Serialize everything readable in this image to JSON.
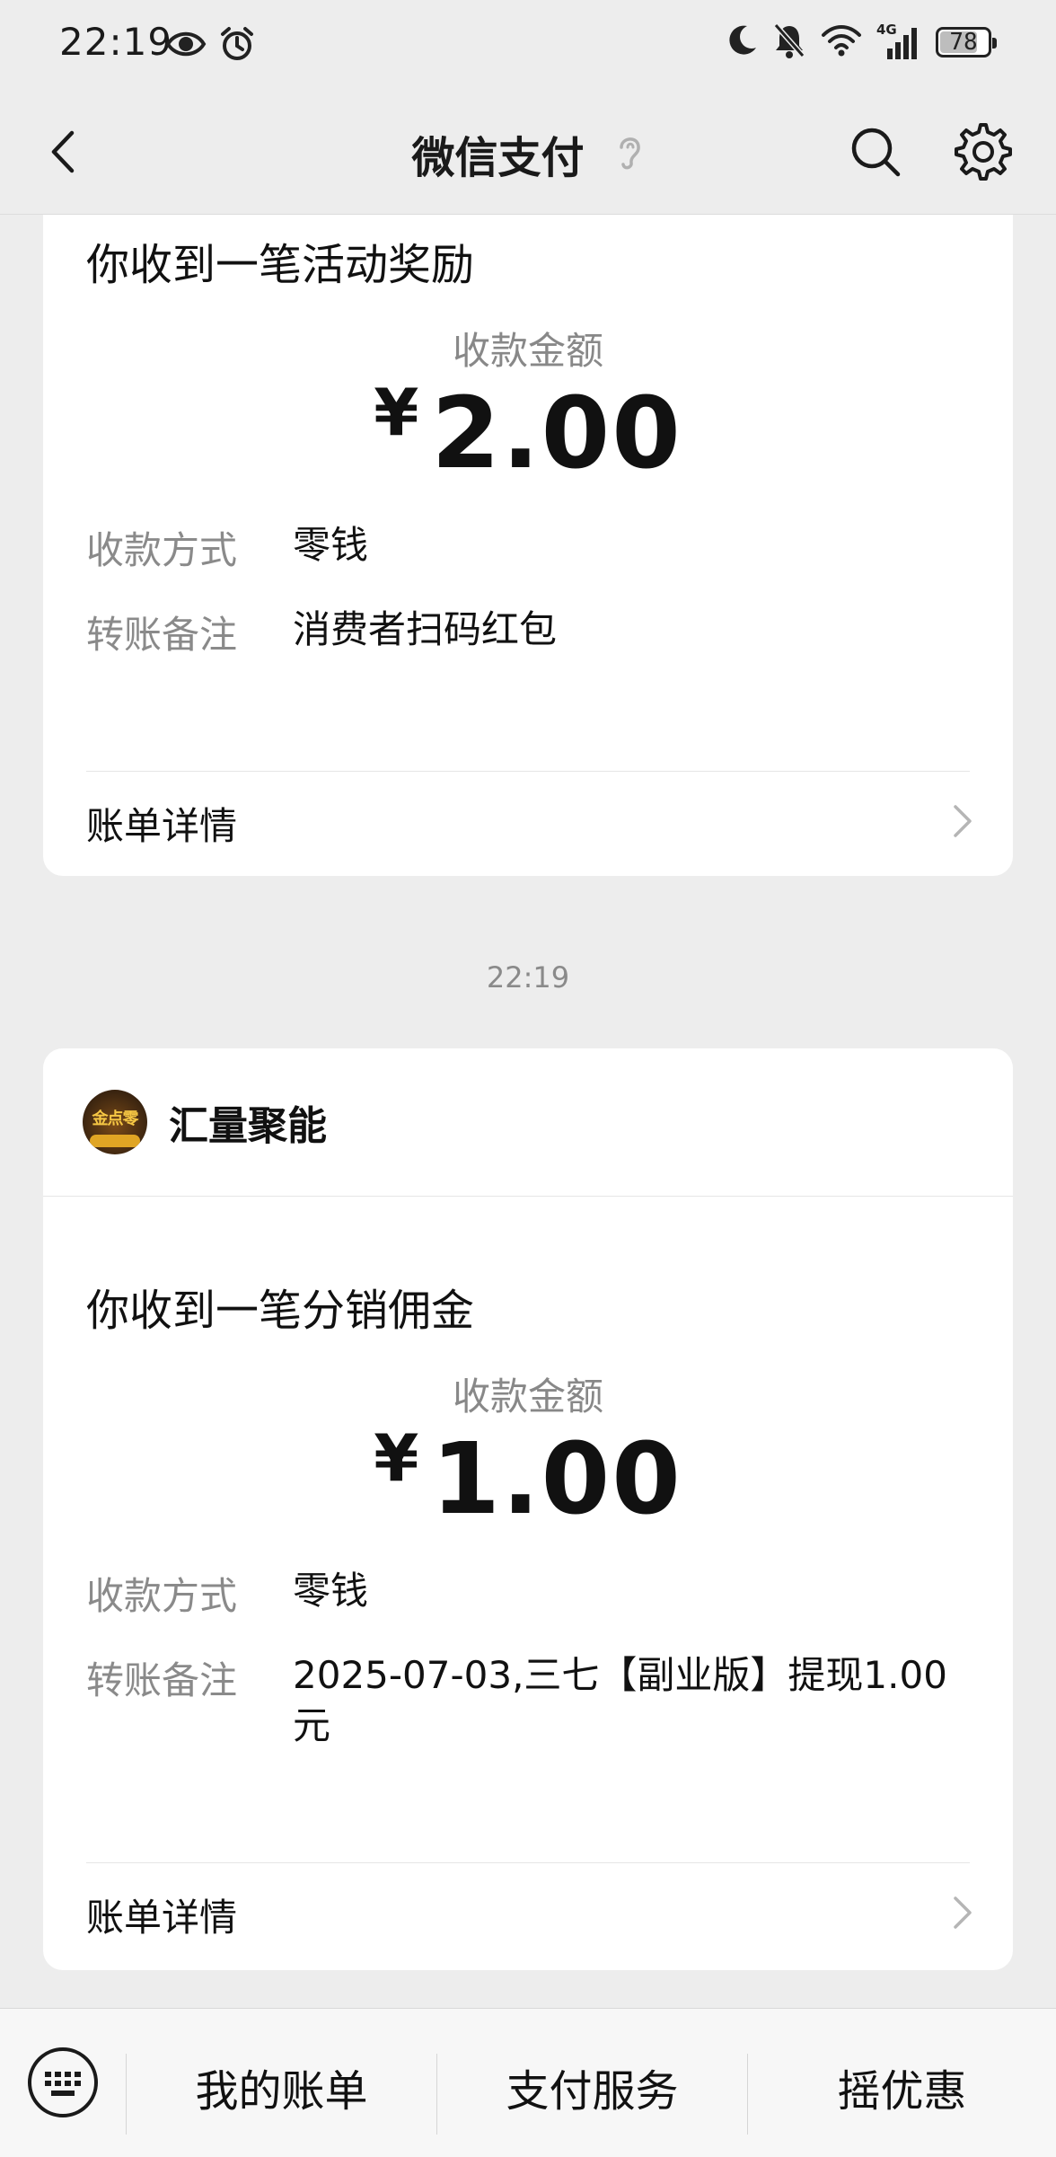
{
  "status_bar": {
    "time": "22:19",
    "left_icons": [
      "eye-icon",
      "alarm-icon"
    ],
    "right_icons": [
      "moon-icon",
      "bell-off-icon",
      "wifi-icon",
      "signal-4g-icon"
    ],
    "network": "4G",
    "battery": "78",
    "battery_level_percent": 78
  },
  "nav": {
    "title": "微信支付",
    "icons": [
      "back-icon",
      "ear-icon",
      "search-icon",
      "settings-icon"
    ]
  },
  "card1": {
    "notice": "你收到一笔活动奖励",
    "amount_label": "收款金额",
    "currency": "¥",
    "amount": "2.00",
    "method_key": "收款方式",
    "method_value": "零钱",
    "remark_key": "转账备注",
    "remark_value": "消费者扫码红包",
    "detail_label": "账单详情"
  },
  "time_separator": "22:19",
  "card2": {
    "avatar_text": "金点零",
    "merchant": "汇量聚能",
    "notice": "你收到一笔分销佣金",
    "amount_label": "收款金额",
    "currency": "¥",
    "amount": "1.00",
    "method_key": "收款方式",
    "method_value": "零钱",
    "remark_key": "转账备注",
    "remark_value": "2025-07-03,三七【副业版】提现1.00元",
    "detail_label": "账单详情"
  },
  "bottom_bar": {
    "keyboard_icon": "keyboard-icon",
    "menus": [
      "我的账单",
      "支付服务",
      "摇优惠"
    ]
  },
  "colors": {
    "page_bg": "#ededed",
    "card_bg": "#ffffff",
    "muted_text": "#888888",
    "primary_text": "#111111"
  }
}
